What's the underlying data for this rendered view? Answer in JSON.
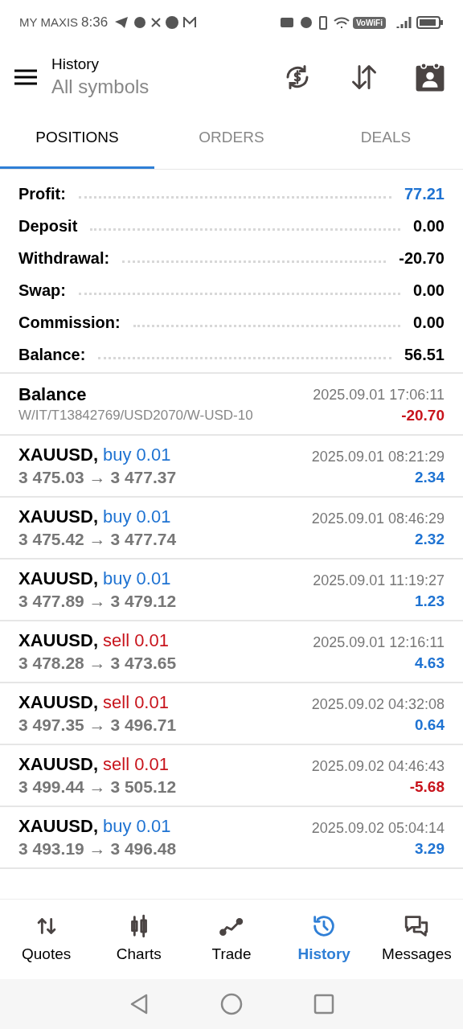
{
  "status_bar": {
    "carrier": "MY MAXIS",
    "time": "8:36",
    "vowifi": "VoWiFi"
  },
  "header": {
    "title": "History",
    "subtitle": "All symbols"
  },
  "tabs": [
    {
      "label": "POSITIONS",
      "selected": true
    },
    {
      "label": "ORDERS",
      "selected": false
    },
    {
      "label": "DEALS",
      "selected": false
    }
  ],
  "summary": [
    {
      "label": "Profit:",
      "value": "77.21",
      "highlight": true
    },
    {
      "label": "Deposit",
      "value": "0.00",
      "highlight": false
    },
    {
      "label": "Withdrawal:",
      "value": "-20.70",
      "highlight": false
    },
    {
      "label": "Swap:",
      "value": "0.00",
      "highlight": false
    },
    {
      "label": "Commission:",
      "value": "0.00",
      "highlight": false
    },
    {
      "label": "Balance:",
      "value": "56.51",
      "highlight": false
    }
  ],
  "rows": [
    {
      "kind": "balance",
      "title": "Balance",
      "detail": "W/IT/T13842769/USD2070/W-USD-10",
      "time": "2025.09.01 17:06:11",
      "profit": "-20.70",
      "loss": true
    },
    {
      "kind": "deal",
      "symbol": "XAUUSD,",
      "sell": false,
      "type": "buy 0.01",
      "prices": "3 475.03 → 3 477.37",
      "time": "2025.09.01 08:21:29",
      "profit": "2.34",
      "loss": false
    },
    {
      "kind": "deal",
      "symbol": "XAUUSD,",
      "sell": false,
      "type": "buy 0.01",
      "prices": "3 475.42 → 3 477.74",
      "time": "2025.09.01 08:46:29",
      "profit": "2.32",
      "loss": false
    },
    {
      "kind": "deal",
      "symbol": "XAUUSD,",
      "sell": false,
      "type": "buy 0.01",
      "prices": "3 477.89 → 3 479.12",
      "time": "2025.09.01 11:19:27",
      "profit": "1.23",
      "loss": false
    },
    {
      "kind": "deal",
      "symbol": "XAUUSD,",
      "sell": true,
      "type": "sell 0.01",
      "prices": "3 478.28 → 3 473.65",
      "time": "2025.09.01 12:16:11",
      "profit": "4.63",
      "loss": false
    },
    {
      "kind": "deal",
      "symbol": "XAUUSD,",
      "sell": true,
      "type": "sell 0.01",
      "prices": "3 497.35 → 3 496.71",
      "time": "2025.09.02 04:32:08",
      "profit": "0.64",
      "loss": false
    },
    {
      "kind": "deal",
      "symbol": "XAUUSD,",
      "sell": true,
      "type": "sell 0.01",
      "prices": "3 499.44 → 3 505.12",
      "time": "2025.09.02 04:46:43",
      "profit": "-5.68",
      "loss": true
    },
    {
      "kind": "deal",
      "symbol": "XAUUSD,",
      "sell": false,
      "type": "buy 0.01",
      "prices": "3 493.19 → 3 496.48",
      "time": "2025.09.02 05:04:14",
      "profit": "3.29",
      "loss": false
    }
  ],
  "nav": [
    {
      "label": "Quotes",
      "selected": false
    },
    {
      "label": "Charts",
      "selected": false
    },
    {
      "label": "Trade",
      "selected": false
    },
    {
      "label": "History",
      "selected": true
    },
    {
      "label": "Messages",
      "selected": false
    }
  ]
}
